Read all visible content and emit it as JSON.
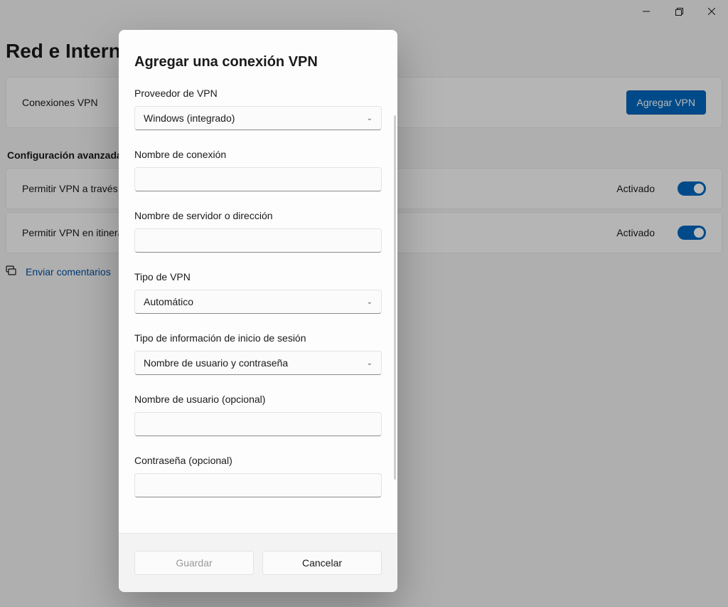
{
  "window": {
    "controls": {
      "minimize": "minimize",
      "maximize": "maximize",
      "close": "close"
    }
  },
  "page": {
    "title": "Red e Internet",
    "vpn_section": {
      "label": "Conexiones VPN",
      "button": "Agregar VPN"
    },
    "advanced_header": "Configuración avanzada de VPN",
    "rows": [
      {
        "label": "Permitir VPN a través de redes de uso medido",
        "state_label": "Activado",
        "state": true
      },
      {
        "label": "Permitir VPN en itinerancia",
        "state_label": "Activado",
        "state": true
      }
    ],
    "feedback": {
      "icon": "feedback-icon",
      "link": "Enviar comentarios"
    }
  },
  "dialog": {
    "title": "Agregar una conexión VPN",
    "fields": {
      "provider": {
        "label": "Proveedor de VPN",
        "value": "Windows (integrado)"
      },
      "connection_name": {
        "label": "Nombre de conexión",
        "value": ""
      },
      "server": {
        "label": "Nombre de servidor o dirección",
        "value": ""
      },
      "vpn_type": {
        "label": "Tipo de VPN",
        "value": "Automático"
      },
      "signin_type": {
        "label": "Tipo de información de inicio de sesión",
        "value": "Nombre de usuario y contraseña"
      },
      "username": {
        "label": "Nombre de usuario (opcional)",
        "value": ""
      },
      "password": {
        "label": "Contraseña (opcional)",
        "value": ""
      }
    },
    "buttons": {
      "save": "Guardar",
      "cancel": "Cancelar"
    }
  }
}
